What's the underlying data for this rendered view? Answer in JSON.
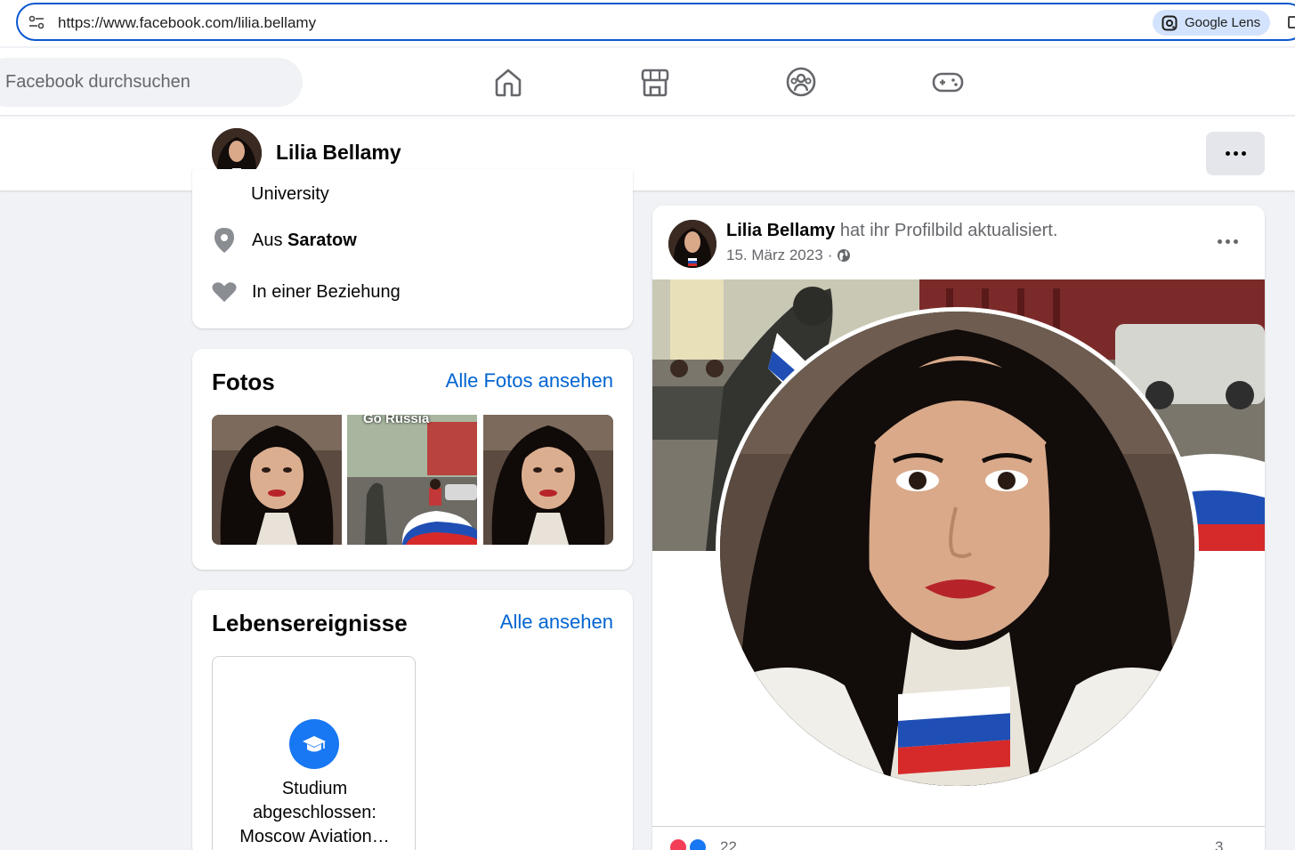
{
  "browser": {
    "url": "https://www.facebook.com/lilia.bellamy",
    "lens_label": "Google Lens"
  },
  "nav": {
    "search_placeholder": "Facebook durchsuchen",
    "icons": [
      "home-icon",
      "marketplace-icon",
      "groups-icon",
      "gaming-icon"
    ]
  },
  "profile": {
    "name": "Lilia Bellamy"
  },
  "intro": {
    "education_tail": "University",
    "from_prefix": "Aus ",
    "from_city": "Saratow",
    "relationship": "In einer Beziehung"
  },
  "photos": {
    "title": "Fotos",
    "link": "Alle Fotos ansehen",
    "thumb2_caption": "Go Russia"
  },
  "events": {
    "title": "Lebensereignisse",
    "link": "Alle ansehen",
    "item_text": "Studium abgeschlossen: Moscow Aviation…"
  },
  "post": {
    "author": "Lilia Bellamy",
    "action": "hat ihr Profilbild aktualisiert.",
    "date": "15. März 2023",
    "privacy_icon": "globe-icon",
    "reaction_count": "22",
    "comment_count": "3"
  },
  "colors": {
    "accent_blue": "#1877f2",
    "link_blue": "#0064d1",
    "background": "#f0f2f5"
  }
}
